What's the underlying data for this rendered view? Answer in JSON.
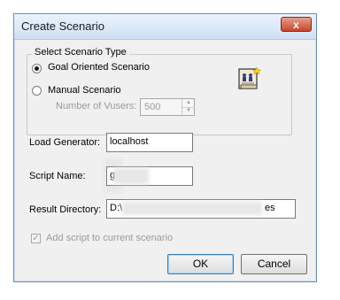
{
  "window": {
    "title": "Create Scenario",
    "close_glyph": "x"
  },
  "scenario_type": {
    "legend": "Select Scenario Type",
    "goal_oriented_label": "Goal Oriented Scenario",
    "manual_label": "Manual Scenario",
    "vusers_label": "Number of Vusers:",
    "vusers_value": "500",
    "selected": "goal_oriented",
    "icon": "scenario-document-icon"
  },
  "fields": {
    "load_generator_label": "Load Generator:",
    "load_generator_value": "localhost",
    "script_name_label": "Script Name:",
    "script_name_value": "g",
    "result_directory_label": "Result Directory:",
    "result_directory_value_start": "D:\\",
    "result_directory_value_end": "es"
  },
  "add_script": {
    "label": "Add script to current scenario",
    "checked": true,
    "enabled": false
  },
  "buttons": {
    "ok": "OK",
    "cancel": "Cancel"
  },
  "colors": {
    "title_bar": "#dbe8f6",
    "close_button": "#c7442a",
    "dialog_bg": "#f0f0f0",
    "disabled_text": "#9a9a9a"
  }
}
